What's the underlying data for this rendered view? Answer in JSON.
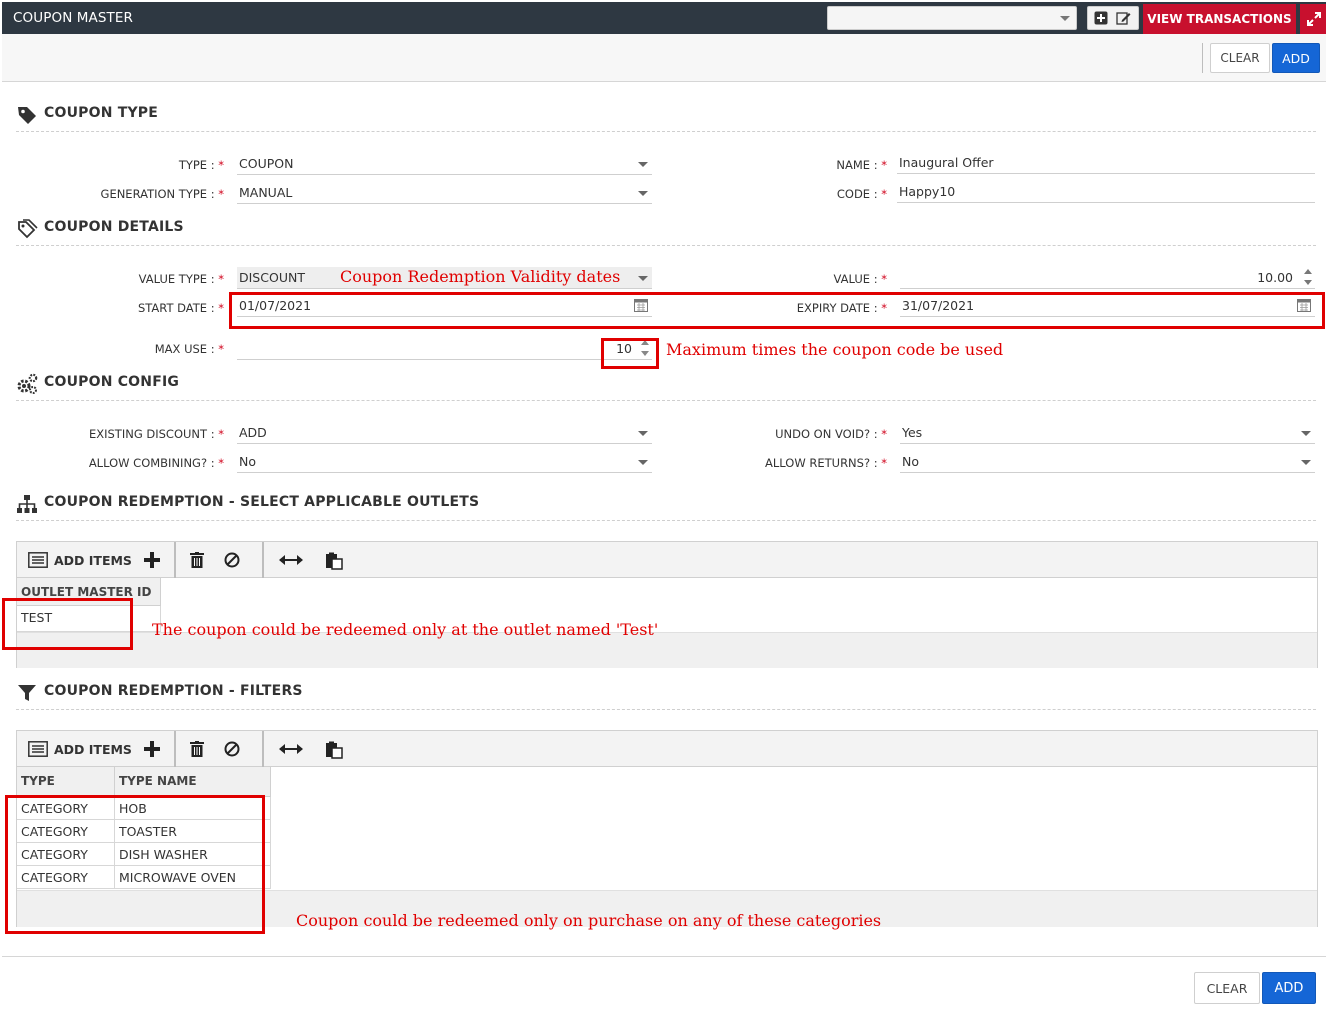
{
  "window": {
    "title": "COUPON MASTER",
    "view_transactions_label": "VIEW TRANSACTIONS",
    "top_select_value": ""
  },
  "actions": {
    "clear_label": "CLEAR",
    "add_label": "ADD"
  },
  "sections": {
    "coupon_type": "COUPON TYPE",
    "coupon_details": "COUPON DETAILS",
    "coupon_config": "COUPON CONFIG",
    "outlets": "COUPON REDEMPTION - SELECT APPLICABLE OUTLETS",
    "filters": "COUPON REDEMPTION - FILTERS"
  },
  "fields": {
    "type": {
      "label": "TYPE :",
      "value": "COUPON"
    },
    "generation_type": {
      "label": "GENERATION TYPE :",
      "value": "MANUAL"
    },
    "name": {
      "label": "NAME :",
      "value": "Inaugural Offer"
    },
    "code": {
      "label": "CODE :",
      "value": "Happy10"
    },
    "value_type": {
      "label": "VALUE TYPE :",
      "value": "DISCOUNT"
    },
    "value": {
      "label": "VALUE :",
      "value": "10.00"
    },
    "start_date": {
      "label": "START DATE :",
      "value": "01/07/2021"
    },
    "expiry_date": {
      "label": "EXPIRY DATE :",
      "value": "31/07/2021"
    },
    "max_use": {
      "label": "MAX USE :",
      "value": "10"
    },
    "existing_discount": {
      "label": "EXISTING DISCOUNT :",
      "value": "ADD"
    },
    "allow_combining": {
      "label": "ALLOW COMBINING? :",
      "value": "No"
    },
    "undo_on_void": {
      "label": "UNDO ON VOID? :",
      "value": "Yes"
    },
    "allow_returns": {
      "label": "ALLOW RETURNS? :",
      "value": "No"
    }
  },
  "required_mark": "*",
  "annotations": {
    "validity": "Coupon Redemption Validity dates",
    "max_use": "Maximum times the coupon code be used",
    "outlet": "The coupon could be redeemed only at the outlet named 'Test'",
    "categories": "Coupon could be redeemed only on purchase on any of these categories"
  },
  "outlet_grid": {
    "add_items_label": "ADD ITEMS",
    "header": "OUTLET MASTER ID",
    "rows": [
      "TEST"
    ]
  },
  "filter_grid": {
    "add_items_label": "ADD ITEMS",
    "headers": [
      "TYPE",
      "TYPE NAME"
    ],
    "rows": [
      [
        "CATEGORY",
        "HOB"
      ],
      [
        "CATEGORY",
        "TOASTER"
      ],
      [
        "CATEGORY",
        "DISH WASHER"
      ],
      [
        "CATEGORY",
        "MICROWAVE OVEN"
      ]
    ]
  },
  "colors": {
    "header_bg": "#2e3842",
    "accent_red": "#c8102e",
    "primary_blue": "#1566d6",
    "annotation_red": "#e00000"
  }
}
